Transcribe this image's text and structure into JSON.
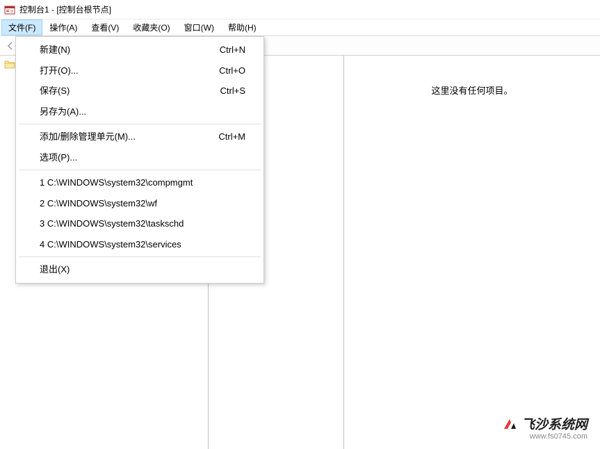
{
  "title": "控制台1 - [控制台根节点]",
  "menubar": {
    "file": "文件(F)",
    "action": "操作(A)",
    "view": "查看(V)",
    "favorites": "收藏夹(O)",
    "window": "窗口(W)",
    "help": "帮助(H)"
  },
  "file_menu": {
    "new": {
      "label": "新建(N)",
      "shortcut": "Ctrl+N"
    },
    "open": {
      "label": "打开(O)...",
      "shortcut": "Ctrl+O"
    },
    "save": {
      "label": "保存(S)",
      "shortcut": "Ctrl+S"
    },
    "saveas": {
      "label": "另存为(A)...",
      "shortcut": ""
    },
    "addremove": {
      "label": "添加/删除管理单元(M)...",
      "shortcut": "Ctrl+M"
    },
    "options": {
      "label": "选项(P)...",
      "shortcut": ""
    },
    "recent1": "1 C:\\WINDOWS\\system32\\compmgmt",
    "recent2": "2 C:\\WINDOWS\\system32\\wf",
    "recent3": "3 C:\\WINDOWS\\system32\\taskschd",
    "recent4": "4 C:\\WINDOWS\\system32\\services",
    "exit": "退出(X)"
  },
  "right_pane": {
    "empty_text": "这里没有任何项目。"
  },
  "watermark": {
    "name": "飞沙系统网",
    "url": "www.fs0745.com"
  }
}
